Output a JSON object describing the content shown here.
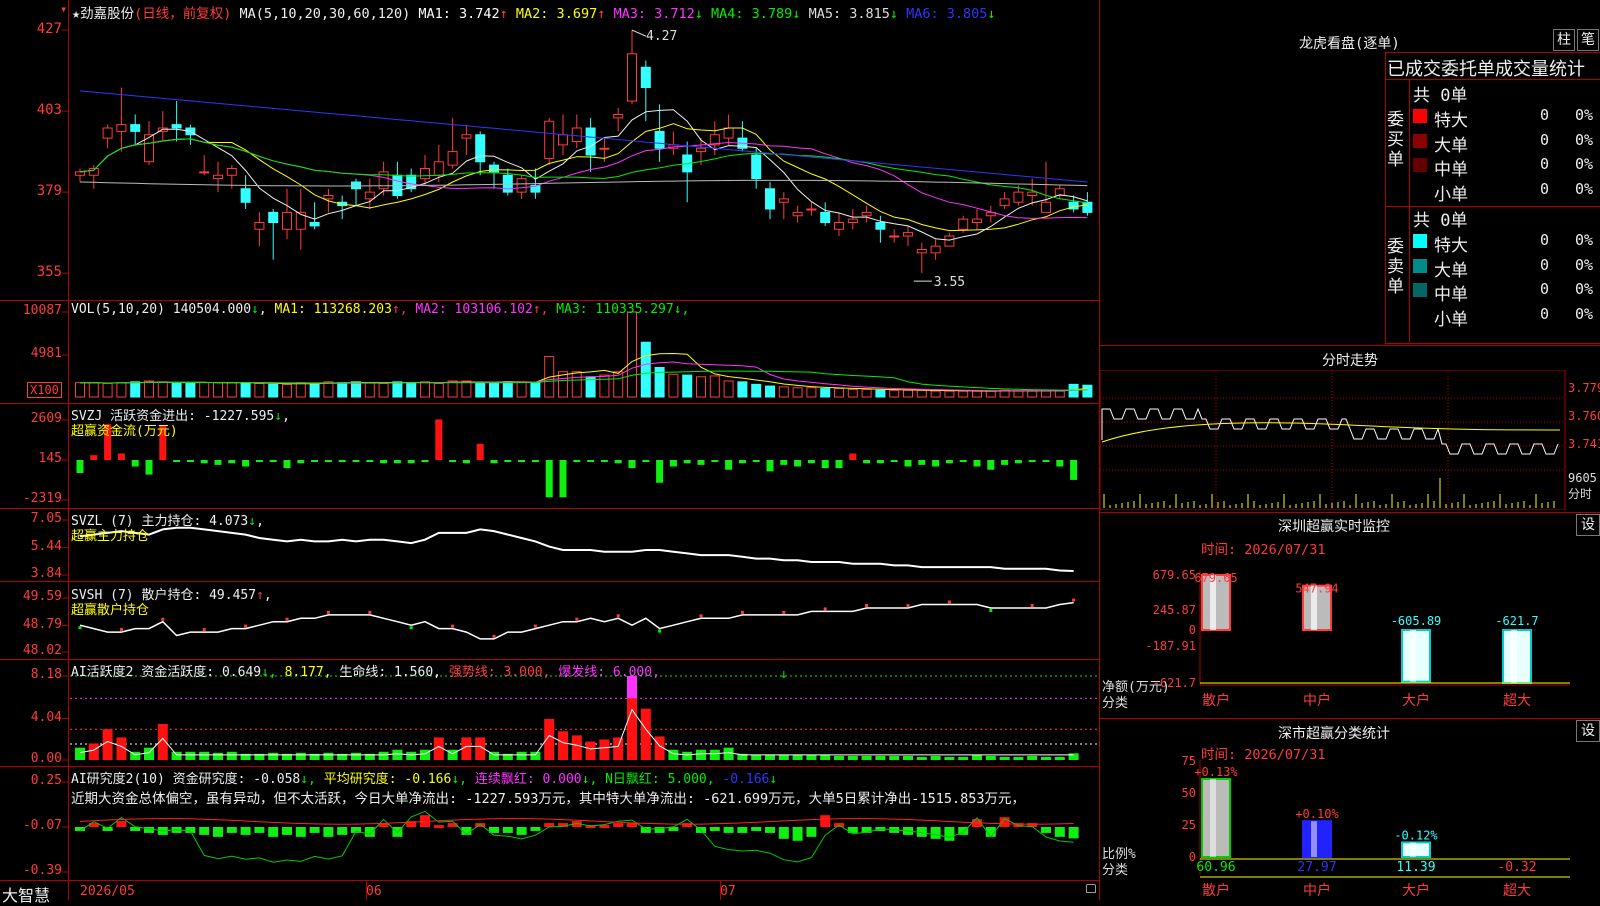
{
  "header": {
    "star": "★",
    "stock_name": "劲嘉股份",
    "period": "(日线，前复权)",
    "ma_label": "MA(5,10,20,30,60,120)",
    "ma_values": [
      {
        "text": "MA1: 3.742",
        "arrow": "↑",
        "color": "#ffffff"
      },
      {
        "text": "MA2: 3.697",
        "arrow": "↑",
        "color": "#ffff00"
      },
      {
        "text": "MA3: 3.712",
        "arrow": "↓",
        "color": "#ff33ff"
      },
      {
        "text": "MA4: 3.789",
        "arrow": "↓",
        "color": "#00ee00"
      },
      {
        "text": "MA5: 3.815",
        "arrow": "↓",
        "color": "#dddddd"
      },
      {
        "text": "MA6: 3.805",
        "arrow": "↓",
        "color": "#3333ff"
      }
    ]
  },
  "main_chart": {
    "y_ticks": [
      "427",
      "403",
      "379",
      "355"
    ],
    "high_label": "4.27",
    "low_label": "3.55"
  },
  "vol_panel": {
    "title": "VOL(5,10,20)",
    "value": "140504.000",
    "arrow": "↓",
    "ma": [
      {
        "text": "MA1: 113268.203",
        "arrow": "↑",
        "color": "#ffff00"
      },
      {
        "text": "MA2: 103106.102",
        "arrow": "↑",
        "color": "#ff33ff"
      },
      {
        "text": "MA3: 110335.297",
        "arrow": "↓",
        "color": "#00ee00"
      }
    ],
    "y_ticks": [
      "10087",
      "4981"
    ],
    "unit_box": "X100"
  },
  "svzj_panel": {
    "title": "SVZJ  活跃资金进出: -1227.595",
    "arrow": "↓",
    "subtitle": "超赢资金流(万元)",
    "y_ticks": [
      "2609",
      "145",
      "-2319"
    ]
  },
  "svzl_panel": {
    "title": "SVZL (7) 主力持仓: 4.073",
    "arrow": "↓",
    "subtitle": "超赢主力持仓",
    "y_ticks": [
      "7.05",
      "5.44",
      "3.84"
    ]
  },
  "svsh_panel": {
    "title": "SVSH (7) 散户持仓: 49.457",
    "arrow": "↑",
    "subtitle": "超赢散户持仓",
    "y_ticks": [
      "49.59",
      "48.79",
      "48.02"
    ]
  },
  "ai_active_panel": {
    "title": "AI活跃度2 资金活跃度: 0.649",
    "v1": "8.177",
    "v2": "生命线: 1.560",
    "v3": "强势线: 3.000",
    "v4": "爆发线: 6.000",
    "y_ticks": [
      "8.18",
      "4.04",
      "0.00"
    ]
  },
  "ai_research_panel": {
    "title": "AI研究度2(10) 资金研究度: -0.058",
    "v1": "平均研究度: -0.166",
    "v2": "连续飘红: 0.000",
    "v3": "N日飘红: 5.000",
    "v4": "-0.166",
    "comment": "近期大资金总体偏空，虽有异动，但不太活跃，今日大单净流出: -1227.593万元，其中特大单净流出: -621.699万元，大单5日累计净出-1515.853万元，",
    "y_ticks": [
      "0.25",
      "-0.07",
      "-0.39"
    ]
  },
  "x_axis": {
    "brand": "大智慧",
    "labels": [
      "2026/05",
      "06",
      "07"
    ]
  },
  "right": {
    "dragon_title": "龙虎看盘(逐单)",
    "btn_zhu": "柱",
    "btn_bi": "笔",
    "stats_title": "已成交委托单成交量统计",
    "buy": {
      "total": "共 0单",
      "side_label": "委买单",
      "rows": [
        {
          "name": "特大",
          "count": "0",
          "pct": "0%",
          "color": "#ff0000"
        },
        {
          "name": "大单",
          "count": "0",
          "pct": "0%",
          "color": "#8b0000"
        },
        {
          "name": "中单",
          "count": "0",
          "pct": "0%",
          "color": "#660000"
        },
        {
          "name": "小单",
          "count": "0",
          "pct": "0%",
          "color": "#000000"
        }
      ]
    },
    "sell": {
      "total": "共 0单",
      "side_label": "委卖单",
      "rows": [
        {
          "name": "特大",
          "count": "0",
          "pct": "0%",
          "color": "#00ffff"
        },
        {
          "name": "大单",
          "count": "0",
          "pct": "0%",
          "color": "#008b8b"
        },
        {
          "name": "中单",
          "count": "0",
          "pct": "0%",
          "color": "#006666"
        },
        {
          "name": "小单",
          "count": "0",
          "pct": "0%",
          "color": "#000000"
        }
      ]
    },
    "intraday": {
      "title": "分时走势",
      "y_ticks": [
        "3.779",
        "3.760",
        "3.741"
      ],
      "vol_label": "9605",
      "time_label": "分时"
    },
    "monitor": {
      "title": "深圳超赢实时监控",
      "btn": "设",
      "time": "时间: 2026/07/31",
      "y_ticks": [
        "679.65",
        "245.87",
        "0",
        "-187.91",
        "-621.7"
      ],
      "axis_label_1": "净额(万元)",
      "axis_label_2": "分类",
      "categories": [
        "散户",
        "中户",
        "大户",
        "超大"
      ],
      "values": [
        679.65,
        547.94,
        -605.89,
        -621.7
      ],
      "value_labels": [
        "679.65",
        "547.94",
        "-605.89",
        "-621.7"
      ]
    },
    "classify": {
      "title": "深市超赢分类统计",
      "btn": "设",
      "time": "时间: 2026/07/31",
      "y_ticks": [
        "75",
        "50",
        "25",
        "0"
      ],
      "axis_label_1": "比例%",
      "axis_label_2": "分类",
      "categories": [
        "散户",
        "中户",
        "大户",
        "超大"
      ],
      "values": [
        60.96,
        27.97,
        11.39,
        -0.32
      ],
      "value_labels": [
        "60.96",
        "27.97",
        "11.39",
        "-0.32"
      ],
      "changes": [
        "+0.13%",
        "+0.10%",
        "-0.12%",
        ""
      ]
    }
  },
  "chart_data": [
    {
      "type": "candlestick",
      "title": "劲嘉股份(日线，前复权)",
      "ylim": [
        3.55,
        4.27
      ],
      "candles": [
        [
          3.84,
          3.85,
          3.82,
          3.86
        ],
        [
          3.84,
          3.86,
          3.8,
          3.87
        ],
        [
          3.95,
          3.98,
          3.92,
          3.99
        ],
        [
          3.97,
          3.99,
          3.91,
          4.1
        ],
        [
          3.99,
          3.97,
          3.93,
          4.02
        ],
        [
          3.88,
          3.96,
          3.87,
          4.0
        ],
        [
          3.97,
          3.98,
          3.94,
          4.03
        ],
        [
          3.99,
          3.98,
          3.94,
          4.06
        ],
        [
          3.98,
          3.96,
          3.93,
          3.99
        ],
        [
          3.85,
          3.85,
          3.84,
          3.9
        ],
        [
          3.83,
          3.84,
          3.79,
          3.88
        ],
        [
          3.84,
          3.86,
          3.8,
          3.87
        ],
        [
          3.8,
          3.76,
          3.74,
          3.84
        ],
        [
          3.68,
          3.7,
          3.63,
          3.73
        ],
        [
          3.73,
          3.7,
          3.59,
          3.74
        ],
        [
          3.68,
          3.73,
          3.65,
          3.8
        ],
        [
          3.68,
          3.73,
          3.62,
          3.8
        ],
        [
          3.7,
          3.69,
          3.68,
          3.76
        ],
        [
          3.77,
          3.78,
          3.73,
          3.8
        ],
        [
          3.76,
          3.75,
          3.71,
          3.78
        ],
        [
          3.82,
          3.8,
          3.75,
          3.83
        ],
        [
          3.77,
          3.79,
          3.74,
          3.83
        ],
        [
          3.8,
          3.85,
          3.78,
          3.88
        ],
        [
          3.84,
          3.78,
          3.77,
          3.88
        ],
        [
          3.84,
          3.8,
          3.79,
          3.86
        ],
        [
          3.83,
          3.86,
          3.81,
          3.9
        ],
        [
          3.84,
          3.88,
          3.82,
          3.93
        ],
        [
          3.87,
          3.91,
          3.86,
          4.01
        ],
        [
          3.95,
          3.96,
          3.9,
          3.99
        ],
        [
          3.96,
          3.88,
          3.84,
          3.97
        ],
        [
          3.87,
          3.85,
          3.8,
          3.88
        ],
        [
          3.84,
          3.79,
          3.78,
          3.86
        ],
        [
          3.79,
          3.83,
          3.77,
          3.84
        ],
        [
          3.81,
          3.79,
          3.77,
          3.86
        ],
        [
          3.89,
          4.0,
          3.87,
          4.01
        ],
        [
          3.93,
          3.96,
          3.9,
          4.02
        ],
        [
          3.94,
          3.98,
          3.92,
          4.02
        ],
        [
          3.98,
          3.9,
          3.85,
          4.01
        ],
        [
          3.92,
          3.92,
          3.88,
          3.95
        ],
        [
          4.01,
          4.02,
          3.97,
          4.04
        ],
        [
          4.06,
          4.2,
          4.05,
          4.27
        ],
        [
          4.16,
          4.1,
          4.0,
          4.18
        ],
        [
          3.97,
          3.92,
          3.88,
          4.05
        ],
        [
          3.92,
          3.93,
          3.9,
          3.97
        ],
        [
          3.9,
          3.85,
          3.76,
          3.94
        ],
        [
          3.91,
          3.92,
          3.87,
          3.95
        ],
        [
          3.93,
          3.96,
          3.9,
          4.0
        ],
        [
          3.95,
          3.98,
          3.93,
          4.02
        ],
        [
          3.95,
          3.92,
          3.91,
          4.0
        ],
        [
          3.9,
          3.83,
          3.8,
          3.92
        ],
        [
          3.8,
          3.74,
          3.71,
          3.82
        ],
        [
          3.76,
          3.77,
          3.71,
          3.79
        ],
        [
          3.72,
          3.73,
          3.7,
          3.75
        ],
        [
          3.74,
          3.74,
          3.72,
          3.76
        ],
        [
          3.73,
          3.7,
          3.69,
          3.76
        ],
        [
          3.68,
          3.7,
          3.66,
          3.73
        ],
        [
          3.7,
          3.71,
          3.68,
          3.74
        ],
        [
          3.72,
          3.73,
          3.7,
          3.75
        ],
        [
          3.7,
          3.68,
          3.64,
          3.72
        ],
        [
          3.66,
          3.66,
          3.64,
          3.68
        ],
        [
          3.66,
          3.67,
          3.63,
          3.69
        ],
        [
          3.61,
          3.62,
          3.55,
          3.64
        ],
        [
          3.61,
          3.63,
          3.59,
          3.65
        ],
        [
          3.63,
          3.66,
          3.63,
          3.67
        ],
        [
          3.68,
          3.71,
          3.67,
          3.72
        ],
        [
          3.7,
          3.71,
          3.68,
          3.74
        ],
        [
          3.72,
          3.73,
          3.7,
          3.75
        ],
        [
          3.75,
          3.77,
          3.74,
          3.79
        ],
        [
          3.76,
          3.79,
          3.75,
          3.81
        ],
        [
          3.78,
          3.79,
          3.75,
          3.83
        ],
        [
          3.73,
          3.76,
          3.73,
          3.88
        ],
        [
          3.78,
          3.8,
          3.77,
          3.81
        ],
        [
          3.76,
          3.74,
          3.73,
          3.78
        ],
        [
          3.76,
          3.73,
          3.72,
          3.79
        ]
      ],
      "ma_current": {
        "MA1": 3.742,
        "MA2": 3.697,
        "MA3": 3.712,
        "MA4": 3.789,
        "MA5": 3.815,
        "MA6": 3.805
      }
    },
    {
      "type": "bar",
      "title": "VOL(5,10,20)",
      "ylim": [
        0,
        10087
      ],
      "last_value": 140504.0,
      "values": [
        1700,
        1700,
        1600,
        1700,
        1800,
        1900,
        1800,
        1600,
        1700,
        1700,
        1700,
        1700,
        1600,
        1600,
        1500,
        1500,
        1700,
        1600,
        1800,
        1700,
        1800,
        1700,
        1600,
        1800,
        1700,
        1800,
        1600,
        1900,
        1900,
        1700,
        1700,
        1800,
        1800,
        1700,
        4800,
        3000,
        3000,
        2400,
        2600,
        3000,
        10087,
        6500,
        3500,
        2700,
        2600,
        2400,
        2500,
        1900,
        1800,
        1500,
        1300,
        1200,
        1100,
        1100,
        1000,
        1000,
        900,
        900,
        800,
        800,
        800,
        800,
        700,
        700,
        700,
        700,
        700,
        800,
        700,
        700,
        700,
        700,
        1500,
        1400
      ]
    },
    {
      "type": "bar",
      "title": "SVZJ 活跃资金进出 超赢资金流(万元)",
      "ylim": [
        -2319,
        2609
      ],
      "last_value": -1227.595,
      "values": [
        -800,
        300,
        2200,
        400,
        -400,
        -900,
        2100,
        -100,
        -100,
        -200,
        -300,
        -200,
        -400,
        -100,
        -100,
        -500,
        -200,
        -100,
        -100,
        -100,
        -100,
        -100,
        -200,
        -200,
        -200,
        -100,
        2500,
        -100,
        -200,
        1000,
        -200,
        -100,
        -100,
        -100,
        -2300,
        -2300,
        -100,
        -100,
        -100,
        -200,
        -500,
        -100,
        -1400,
        -400,
        -200,
        -300,
        -100,
        -600,
        -200,
        -100,
        -700,
        -300,
        -400,
        -200,
        -500,
        -500,
        400,
        -200,
        -200,
        -100,
        -400,
        -300,
        -400,
        -200,
        -100,
        -400,
        -600,
        -300,
        -200,
        -100,
        -100,
        -400,
        -1227.595
      ]
    },
    {
      "type": "line",
      "title": "SVZL (7) 主力持仓",
      "ylim": [
        3.84,
        7.05
      ],
      "last_value": 4.073,
      "values": [
        6.1,
        6.2,
        6.3,
        6.4,
        6.3,
        6.2,
        6.5,
        6.6,
        6.6,
        6.5,
        6.4,
        6.3,
        6.2,
        6.0,
        5.9,
        5.8,
        5.9,
        5.8,
        5.8,
        5.9,
        5.8,
        5.9,
        5.9,
        5.8,
        5.7,
        5.9,
        6.3,
        6.3,
        6.3,
        6.5,
        6.4,
        6.2,
        6.0,
        5.8,
        5.5,
        5.3,
        5.3,
        5.3,
        5.2,
        5.2,
        5.2,
        5.3,
        5.3,
        5.2,
        5.1,
        5.0,
        5.0,
        5.0,
        4.9,
        4.8,
        4.8,
        4.7,
        4.7,
        4.6,
        4.6,
        4.6,
        4.5,
        4.5,
        4.5,
        4.4,
        4.4,
        4.3,
        4.3,
        4.3,
        4.3,
        4.3,
        4.3,
        4.2,
        4.2,
        4.2,
        4.2,
        4.1,
        4.073
      ]
    },
    {
      "type": "line",
      "title": "SVSH (7) 散户持仓",
      "ylim": [
        48.02,
        49.59
      ],
      "last_value": 49.457,
      "values": [
        48.8,
        48.7,
        48.6,
        48.6,
        48.7,
        48.7,
        48.9,
        48.5,
        48.6,
        48.6,
        48.6,
        48.7,
        48.7,
        48.8,
        48.9,
        48.9,
        49.0,
        49.0,
        49.1,
        49.1,
        49.1,
        49.1,
        49.0,
        48.9,
        48.8,
        48.9,
        48.7,
        48.7,
        48.6,
        48.4,
        48.4,
        48.6,
        48.6,
        48.7,
        48.8,
        48.9,
        48.9,
        49.0,
        48.9,
        49.0,
        48.8,
        49.0,
        48.7,
        48.8,
        48.9,
        49.0,
        49.0,
        49.0,
        49.1,
        49.1,
        49.1,
        49.1,
        49.1,
        49.2,
        49.2,
        49.2,
        49.2,
        49.3,
        49.3,
        49.3,
        49.3,
        49.4,
        49.4,
        49.4,
        49.4,
        49.4,
        49.3,
        49.3,
        49.3,
        49.3,
        49.3,
        49.4,
        49.457
      ]
    },
    {
      "type": "bar",
      "title": "AI活跃度2 资金活跃度",
      "ylim": [
        0,
        8.18
      ],
      "last_value": 0.649,
      "values": [
        1.2,
        1.6,
        3.0,
        2.2,
        0.8,
        1.2,
        3.5,
        0.8,
        0.8,
        0.8,
        0.7,
        0.8,
        0.6,
        0.6,
        0.7,
        0.6,
        0.7,
        0.6,
        0.7,
        0.6,
        0.7,
        0.6,
        0.8,
        1.0,
        0.8,
        1.0,
        2.2,
        1.0,
        2.2,
        2.2,
        0.8,
        0.6,
        0.8,
        0.8,
        4.0,
        2.8,
        2.4,
        1.8,
        2.0,
        2.2,
        8.18,
        5.0,
        2.3,
        1.0,
        0.8,
        1.0,
        1.0,
        1.2,
        0.6,
        0.5,
        0.5,
        0.5,
        0.5,
        0.5,
        0.5,
        0.4,
        0.4,
        0.4,
        0.4,
        0.4,
        0.4,
        0.3,
        0.4,
        0.3,
        0.3,
        0.5,
        0.4,
        0.3,
        0.3,
        0.4,
        0.3,
        0.3,
        0.649
      ]
    },
    {
      "type": "bar",
      "title": "AI研究度2(10) 资金研究度",
      "ylim": [
        -0.39,
        0.25
      ],
      "last_value": -0.058,
      "values": [
        -0.02,
        0.02,
        -0.02,
        0.03,
        -0.02,
        -0.03,
        -0.04,
        -0.03,
        -0.03,
        -0.04,
        -0.05,
        -0.03,
        -0.04,
        -0.03,
        -0.05,
        -0.04,
        -0.05,
        -0.03,
        -0.05,
        -0.04,
        -0.03,
        -0.05,
        0.02,
        -0.05,
        0.03,
        0.06,
        0.01,
        0.02,
        -0.04,
        0.02,
        -0.03,
        -0.03,
        -0.04,
        -0.02,
        0.02,
        0.02,
        0.03,
        0.01,
        0.01,
        0.02,
        0.02,
        -0.03,
        -0.03,
        -0.02,
        0.02,
        -0.03,
        -0.02,
        -0.03,
        -0.03,
        -0.02,
        -0.03,
        -0.06,
        -0.07,
        -0.05,
        0.06,
        0.02,
        -0.03,
        -0.03,
        -0.02,
        -0.03,
        -0.04,
        -0.05,
        -0.06,
        -0.07,
        -0.04,
        0.04,
        -0.05,
        0.05,
        0.02,
        0.02,
        -0.03,
        -0.05,
        -0.058
      ]
    },
    {
      "type": "bar",
      "title": "深圳超赢实时监控",
      "categories": [
        "散户",
        "中户",
        "大户",
        "超大"
      ],
      "values": [
        679.65,
        547.94,
        -605.89,
        -621.7
      ],
      "ylabel": "净额(万元)",
      "xlabel": "分类",
      "ylim": [
        -621.7,
        679.65
      ]
    },
    {
      "type": "bar",
      "title": "深市超赢分类统计",
      "categories": [
        "散户",
        "中户",
        "大户",
        "超大"
      ],
      "values": [
        60.96,
        27.97,
        11.39,
        -0.32
      ],
      "ylabel": "比例%",
      "xlabel": "分类",
      "ylim": [
        0,
        75
      ]
    }
  ]
}
